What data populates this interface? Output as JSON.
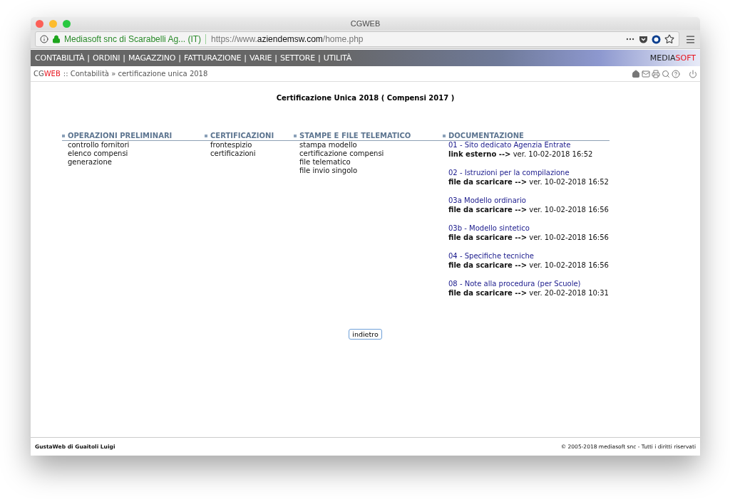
{
  "window": {
    "title": "CGWEB"
  },
  "browser": {
    "site_identity": "Mediasoft snc di Scarabelli Ag... (IT)",
    "url_prefix": "https://www.",
    "url_domain": "aziendemsw.com",
    "url_path": "/home.php"
  },
  "menu": {
    "items": [
      "CONTABILITÀ",
      "ORDINI",
      "MAGAZZINO",
      "FATTURAZIONE",
      "VARIE",
      "SETTORE",
      "UTILITÀ"
    ],
    "separator": "|",
    "brand": {
      "first": "MEDIA",
      "second": "SOFT"
    }
  },
  "breadcrumb": {
    "logo": {
      "first": "CG",
      "second": "WEB"
    },
    "path": ":: Contabilità » certificazione unica 2018"
  },
  "page_title": "Certificazione Unica 2018 ( Compensi 2017 )",
  "sections": [
    {
      "heading": "OPERAZIONI PRELIMINARI",
      "links": [
        "controllo fornitori",
        "elenco compensi",
        "generazione"
      ]
    },
    {
      "heading": "CERTIFICAZIONI",
      "links": [
        "frontespizio",
        "certificazioni"
      ]
    },
    {
      "heading": "STAMPE E FILE TELEMATICO",
      "links": [
        "stampa modello",
        "certificazione compensi",
        "file telematico",
        "file invio singolo"
      ]
    }
  ],
  "documentation": {
    "heading": "DOCUMENTAZIONE",
    "items": [
      {
        "title": "01 - Sito dedicato Agenzia Entrate",
        "info": "**link esterno -->** ver. 10-02-2018 16:52"
      },
      {
        "title": "02 - Istruzioni per la compilazione",
        "info": "**file da scaricare -->** ver. 10-02-2018 16:52"
      },
      {
        "title": "03a Modello ordinario",
        "info": "**file da scaricare -->** ver. 10-02-2018 16:56"
      },
      {
        "title": "03b - Modello sintetico",
        "info": "**file da scaricare -->** ver. 10-02-2018 16:56"
      },
      {
        "title": "04 - Specifiche tecniche",
        "info": "**file da scaricare -->** ver. 10-02-2018 16:56"
      },
      {
        "title": "08 - Note alla procedura (per Scuole)",
        "info": "**file da scaricare -->** ver. 20-02-2018 10:31"
      }
    ]
  },
  "back_button": "indietro",
  "footer": {
    "left": "GustaWeb di Guaitoli Luigi",
    "right": "© 2005-2018 mediasoft snc - Tutti i diritti riservati"
  }
}
